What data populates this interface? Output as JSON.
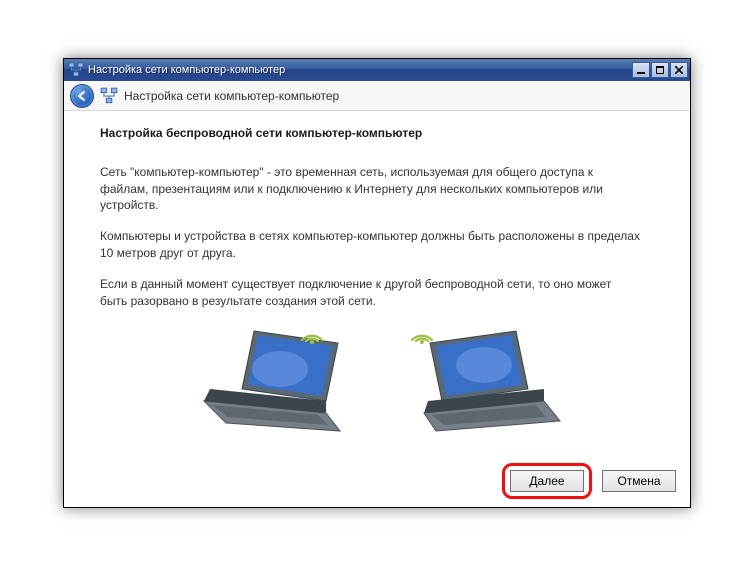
{
  "titlebar": {
    "title": "Настройка сети компьютер-компьютер"
  },
  "header": {
    "title": "Настройка сети компьютер-компьютер"
  },
  "content": {
    "heading": "Настройка беспроводной сети компьютер-компьютер",
    "para1": "Сеть \"компьютер-компьютер\" - это временная сеть, используемая для общего доступа к файлам, презентациям или к подключению к Интернету для нескольких компьютеров или устройств.",
    "para2": "Компьютеры и устройства в сетях компьютер-компьютер должны быть расположены в пределах 10 метров друг от друга.",
    "para3": "Если в данный момент существует подключение к другой беспроводной сети, то оно может быть разорвано в результате создания этой сети."
  },
  "buttons": {
    "next": "Далее",
    "cancel": "Отмена"
  }
}
